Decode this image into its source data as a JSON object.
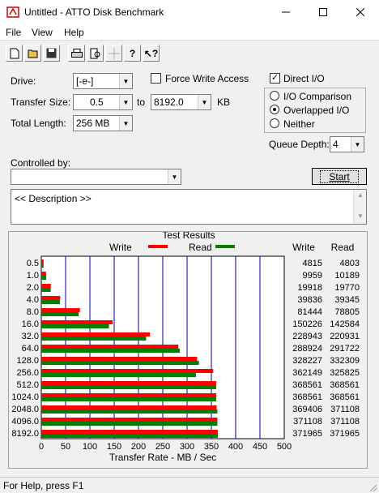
{
  "window": {
    "title": "Untitled - ATTO Disk Benchmark"
  },
  "menu": [
    "File",
    "View",
    "Help"
  ],
  "toolbar": {
    "icons": [
      "new-icon",
      "open-icon",
      "save-icon",
      "print-icon",
      "print-preview-icon",
      "move-icon",
      "help-icon",
      "context-help-icon"
    ]
  },
  "drive": {
    "label": "Drive:",
    "value": "[-e-]"
  },
  "force_write": {
    "label": "Force Write Access",
    "checked": false
  },
  "direct_io": {
    "label": "Direct I/O",
    "checked": true
  },
  "io_comparison": {
    "label": "I/O Comparison"
  },
  "overlapped_io": {
    "label": "Overlapped I/O"
  },
  "neither": {
    "label": "Neither"
  },
  "transfer_size": {
    "label": "Transfer Size:",
    "from": "0.5",
    "to_label": "to",
    "to": "8192.0",
    "unit": "KB"
  },
  "total_length": {
    "label": "Total Length:",
    "value": "256 MB"
  },
  "queue_depth": {
    "label": "Queue Depth:",
    "value": "4"
  },
  "controlled_by": {
    "label": "Controlled by:",
    "value": ""
  },
  "start_button": "Start",
  "description": "<< Description >>",
  "results_title": "Test Results",
  "legend": {
    "write": "Write",
    "read": "Read"
  },
  "col_write": "Write",
  "col_read": "Read",
  "chart_data": {
    "type": "bar",
    "orientation": "horizontal",
    "categories": [
      "0.5",
      "1.0",
      "2.0",
      "4.0",
      "8.0",
      "16.0",
      "32.0",
      "64.0",
      "128.0",
      "256.0",
      "512.0",
      "1024.0",
      "2048.0",
      "4096.0",
      "8192.0"
    ],
    "series": [
      {
        "name": "Write",
        "color": "#ff0000",
        "values": [
          4815,
          9959,
          19918,
          39836,
          81444,
          150226,
          228943,
          288924,
          328227,
          362149,
          368561,
          368561,
          369406,
          371108,
          371965
        ]
      },
      {
        "name": "Read",
        "color": "#008000",
        "values": [
          4803,
          10189,
          19770,
          39345,
          78805,
          142584,
          220931,
          291722,
          332309,
          325825,
          368561,
          368561,
          371108,
          371108,
          371965
        ]
      }
    ],
    "xlabel": "Transfer Rate - MB / Sec",
    "xticks": [
      "0",
      "50",
      "100",
      "150",
      "200",
      "250",
      "300",
      "350",
      "400",
      "450",
      "500"
    ],
    "xlim": [
      0,
      500
    ]
  },
  "status": "For Help, press F1"
}
